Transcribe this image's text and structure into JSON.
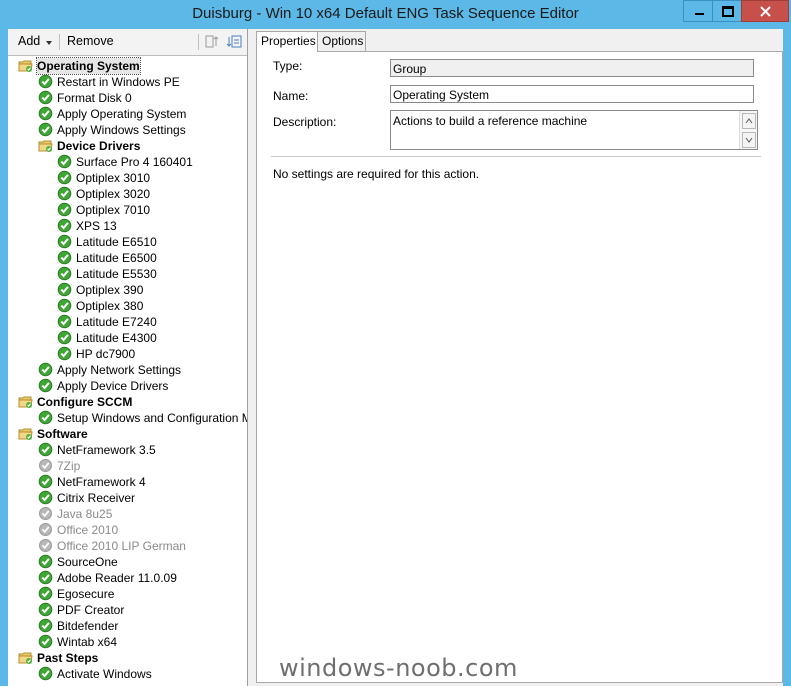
{
  "window": {
    "title": "Duisburg - Win 10 x64 Default ENG Task Sequence Editor",
    "accent_color": "#5cb8e6",
    "close_color": "#c7504a"
  },
  "toolbar": {
    "add_label": "Add",
    "remove_label": "Remove"
  },
  "tree": [
    {
      "label": "Operating System",
      "type": "group",
      "level": 0,
      "status": "folder"
    },
    {
      "label": "Restart in Windows PE",
      "type": "step",
      "level": 1,
      "status": "ok"
    },
    {
      "label": "Format Disk 0",
      "type": "step",
      "level": 1,
      "status": "ok"
    },
    {
      "label": "Apply Operating System",
      "type": "step",
      "level": 1,
      "status": "ok"
    },
    {
      "label": "Apply Windows Settings",
      "type": "step",
      "level": 1,
      "status": "ok"
    },
    {
      "label": "Device Drivers",
      "type": "group",
      "level": 1,
      "status": "folder"
    },
    {
      "label": "Surface Pro 4 160401",
      "type": "step",
      "level": 2,
      "status": "ok"
    },
    {
      "label": "Optiplex 3010",
      "type": "step",
      "level": 2,
      "status": "ok"
    },
    {
      "label": "Optiplex 3020",
      "type": "step",
      "level": 2,
      "status": "ok"
    },
    {
      "label": "Optiplex 7010",
      "type": "step",
      "level": 2,
      "status": "ok"
    },
    {
      "label": "XPS 13",
      "type": "step",
      "level": 2,
      "status": "ok"
    },
    {
      "label": "Latitude E6510",
      "type": "step",
      "level": 2,
      "status": "ok"
    },
    {
      "label": "Latitude E6500",
      "type": "step",
      "level": 2,
      "status": "ok"
    },
    {
      "label": "Latitude E5530",
      "type": "step",
      "level": 2,
      "status": "ok"
    },
    {
      "label": "Optiplex 390",
      "type": "step",
      "level": 2,
      "status": "ok"
    },
    {
      "label": "Optiplex 380",
      "type": "step",
      "level": 2,
      "status": "ok"
    },
    {
      "label": "Latitude E7240",
      "type": "step",
      "level": 2,
      "status": "ok"
    },
    {
      "label": "Latitude E4300",
      "type": "step",
      "level": 2,
      "status": "ok"
    },
    {
      "label": "HP dc7900",
      "type": "step",
      "level": 2,
      "status": "ok"
    },
    {
      "label": "Apply Network Settings",
      "type": "step",
      "level": 1,
      "status": "ok"
    },
    {
      "label": "Apply Device Drivers",
      "type": "step",
      "level": 1,
      "status": "ok"
    },
    {
      "label": "Configure SCCM",
      "type": "group",
      "level": 0,
      "status": "folder"
    },
    {
      "label": "Setup Windows and Configuration Manager",
      "type": "step",
      "level": 1,
      "status": "ok"
    },
    {
      "label": "Software",
      "type": "group",
      "level": 0,
      "status": "folder"
    },
    {
      "label": "NetFramework 3.5",
      "type": "step",
      "level": 1,
      "status": "ok"
    },
    {
      "label": "7Zip",
      "type": "step",
      "level": 1,
      "status": "disabled"
    },
    {
      "label": "NetFramework 4",
      "type": "step",
      "level": 1,
      "status": "ok"
    },
    {
      "label": "Citrix Receiver",
      "type": "step",
      "level": 1,
      "status": "ok"
    },
    {
      "label": "Java 8u25",
      "type": "step",
      "level": 1,
      "status": "disabled"
    },
    {
      "label": "Office 2010",
      "type": "step",
      "level": 1,
      "status": "disabled"
    },
    {
      "label": "Office 2010 LIP German",
      "type": "step",
      "level": 1,
      "status": "disabled"
    },
    {
      "label": "SourceOne",
      "type": "step",
      "level": 1,
      "status": "ok"
    },
    {
      "label": "Adobe Reader 11.0.09",
      "type": "step",
      "level": 1,
      "status": "ok"
    },
    {
      "label": "Egosecure",
      "type": "step",
      "level": 1,
      "status": "ok"
    },
    {
      "label": "PDF Creator",
      "type": "step",
      "level": 1,
      "status": "ok"
    },
    {
      "label": "Bitdefender",
      "type": "step",
      "level": 1,
      "status": "ok"
    },
    {
      "label": "Wintab x64",
      "type": "step",
      "level": 1,
      "status": "ok"
    },
    {
      "label": "Past Steps",
      "type": "group",
      "level": 0,
      "status": "folder"
    },
    {
      "label": "Activate Windows",
      "type": "step",
      "level": 1,
      "status": "ok"
    }
  ],
  "tabs": [
    {
      "label": "Properties",
      "active": true
    },
    {
      "label": "Options",
      "active": false
    }
  ],
  "properties": {
    "type_label": "Type:",
    "type_value": "Group",
    "name_label": "Name:",
    "name_value": "Operating System",
    "description_label": "Description:",
    "description_value": "Actions to build a reference machine",
    "note": "No settings are required  for this action."
  },
  "watermark": "windows-noob.com"
}
